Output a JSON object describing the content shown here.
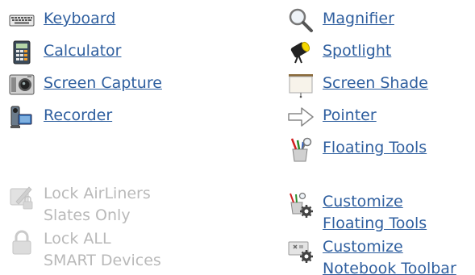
{
  "left_column": [
    {
      "label": "Keyboard",
      "icon": "keyboard-icon"
    },
    {
      "label": "Calculator",
      "icon": "calculator-icon"
    },
    {
      "label": "Screen Capture",
      "icon": "camera-icon"
    },
    {
      "label": "Recorder",
      "icon": "video-camera-icon"
    }
  ],
  "right_column": [
    {
      "label": "Magnifier",
      "icon": "magnifier-icon"
    },
    {
      "label": "Spotlight",
      "icon": "spotlight-icon"
    },
    {
      "label": "Screen Shade",
      "icon": "screen-shade-icon"
    },
    {
      "label": "Pointer",
      "icon": "arrow-pointer-icon"
    },
    {
      "label": "Floating Tools",
      "icon": "pen-cup-icon"
    }
  ],
  "disabled_items": [
    {
      "line1": "Lock AirLiners",
      "line2": "Slates Only",
      "icon": "slate-lock-icon"
    },
    {
      "line1": "Lock ALL",
      "line2": "SMART Devices",
      "icon": "padlock-icon"
    }
  ],
  "customize_items": [
    {
      "line1": "Customize",
      "line2": "Floating Tools",
      "icon": "pen-cup-gear-icon"
    },
    {
      "line1": "Customize",
      "line2": "Notebook Toolbar",
      "icon": "toolbar-gear-icon"
    }
  ],
  "colors": {
    "link": "#2f5f9f",
    "disabled": "#b9b9b9",
    "background": "#ffffff"
  }
}
